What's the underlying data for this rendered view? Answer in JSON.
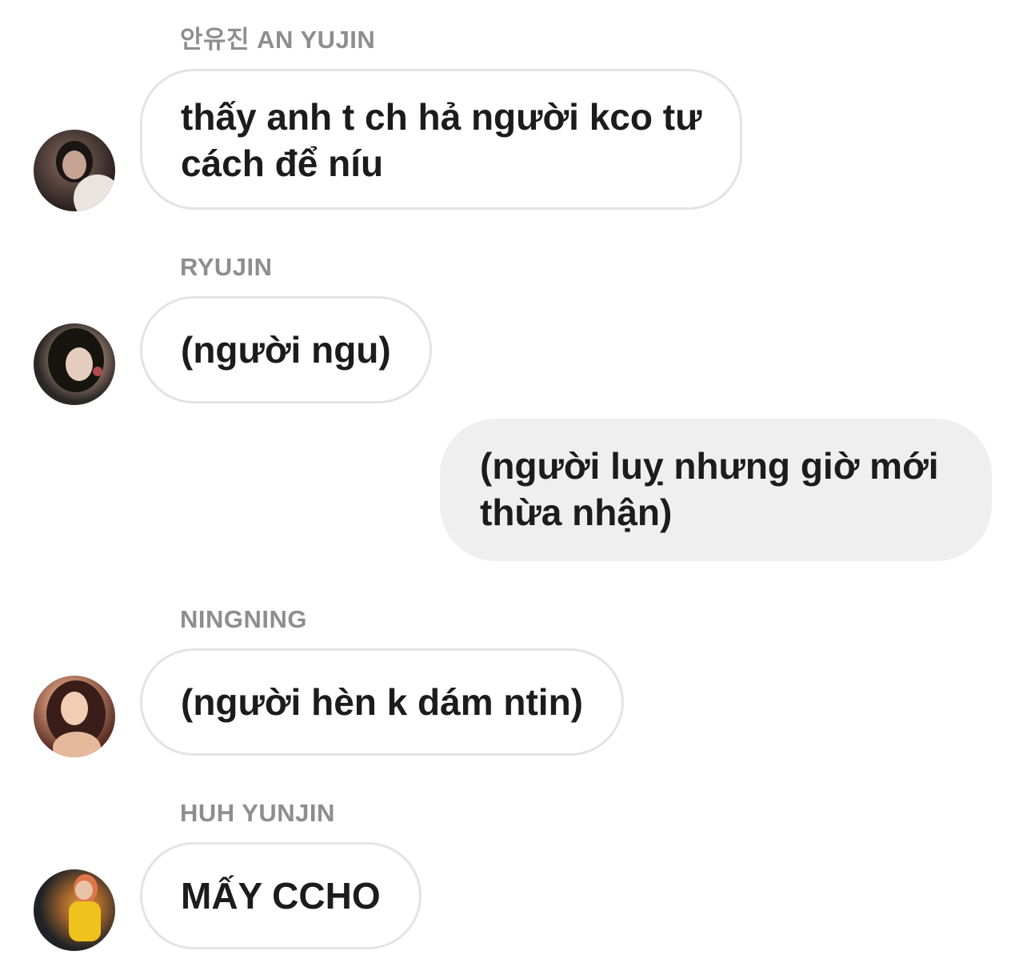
{
  "messages": [
    {
      "sender": "안유진 AN YUJIN",
      "direction": "incoming",
      "avatar_icon": "profile-photo-icon",
      "lines": [
        "thấy anh t ch hả người kco tư",
        "cách để níu"
      ]
    },
    {
      "sender": "RYUJIN",
      "direction": "incoming",
      "avatar_icon": "profile-photo-icon",
      "lines": [
        "(người ngu)"
      ]
    },
    {
      "sender": "",
      "direction": "outgoing",
      "lines": [
        "(người luỵ nhưng giờ mới",
        "thừa nhận)"
      ]
    },
    {
      "sender": "NINGNING",
      "direction": "incoming",
      "avatar_icon": "profile-photo-icon",
      "lines": [
        "(người hèn k dám ntin)"
      ]
    },
    {
      "sender": "HUH YUNJIN",
      "direction": "incoming",
      "avatar_icon": "profile-photo-icon",
      "lines": [
        "MẤY CCHO"
      ]
    }
  ],
  "colors": {
    "sender_name": "#8e8e8e",
    "incoming_border": "#e3e3e3",
    "outgoing_bg": "#efefef",
    "text": "#1c1c1c"
  }
}
